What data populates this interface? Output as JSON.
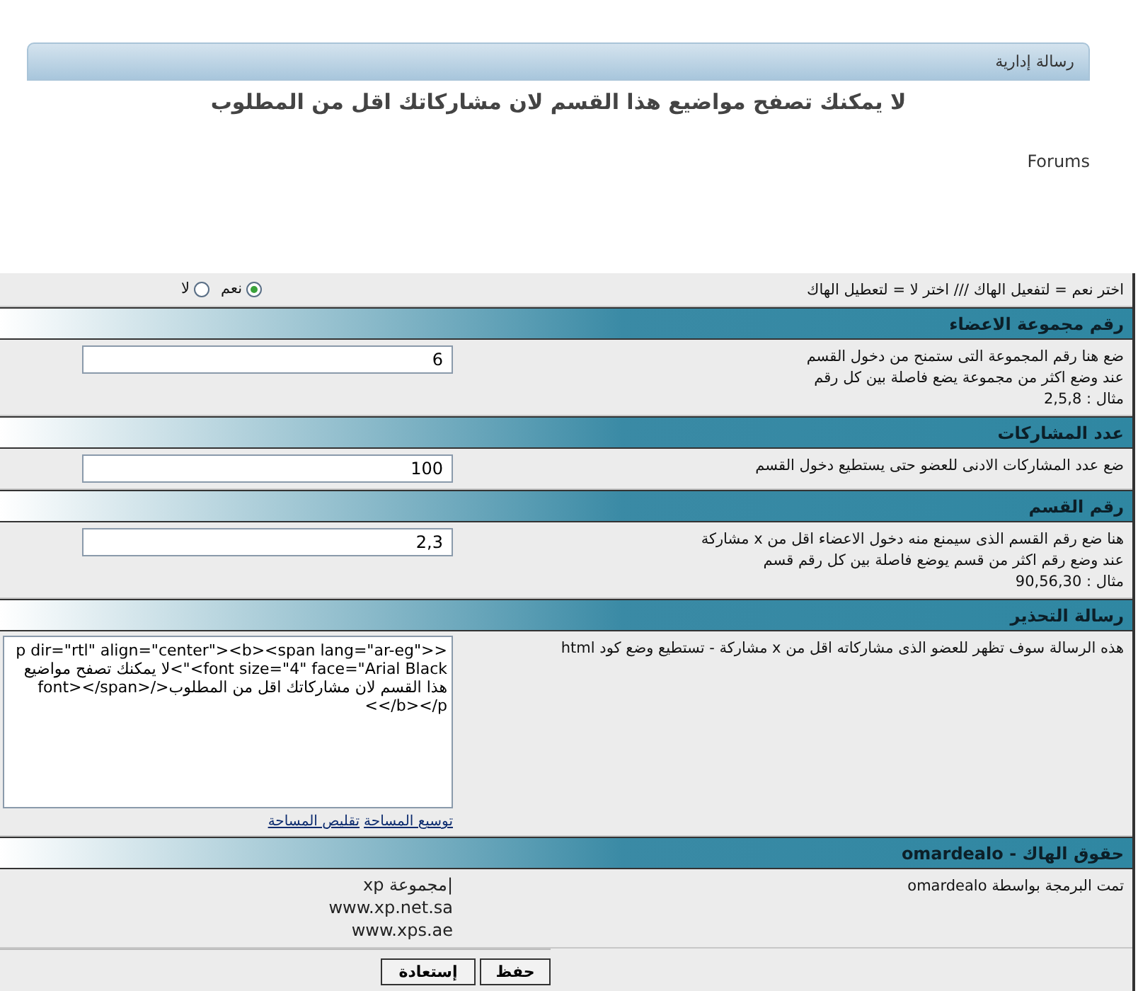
{
  "message_panel": {
    "title": "رسالة إدارية",
    "text": "لا يمكنك تصفح مواضيع هذا القسم لان مشاركاتك اقل من المطلوب"
  },
  "breadcrumb": "Forums",
  "form": [
    {
      "kind": "radio",
      "description": [
        "اختر نعم = لتفعيل الهاك /// اختر لا = لتعطيل الهاك"
      ],
      "options": [
        {
          "label": "نعم",
          "selected": true
        },
        {
          "label": "لا",
          "selected": false
        }
      ]
    },
    {
      "kind": "header",
      "title": "رقم مجموعة الاعضاء"
    },
    {
      "kind": "input",
      "description": [
        "ضع هنا رقم المجموعة التى ستمنح من دخول القسم",
        "عند وضع اكثر من مجموعة يضع فاصلة بين كل رقم",
        "مثال : 2,5,8"
      ],
      "value": "6"
    },
    {
      "kind": "header",
      "title": "عدد المشاركات"
    },
    {
      "kind": "input",
      "description": [
        "ضع عدد المشاركات الادنى للعضو حتى يستطيع دخول القسم"
      ],
      "value": "100"
    },
    {
      "kind": "header",
      "title": "رقم القسم"
    },
    {
      "kind": "input",
      "description": [
        "هنا ضع رقم القسم الذى سيمنع منه دخول الاعضاء اقل من x مشاركة",
        "عند وضع رقم اكثر من قسم يوضع فاصلة بين كل رقم قسم",
        "مثال : 90,56,30"
      ],
      "value": "2,3"
    },
    {
      "kind": "header",
      "title": "رسالة التحذير"
    },
    {
      "kind": "textarea",
      "description": [
        "هذه الرسالة سوف تظهر للعضو الذى مشاركاته اقل من x مشاركة - تستطيع وضع كود html"
      ],
      "value": "<p dir=\"rtl\" align=\"center\"><b><span lang=\"ar-eg\"><font size=\"4\" face=\"Arial Black\">لا يمكنك تصفح مواضيع هذا القسم لان مشاركاتك اقل من المطلوب</font></span></b></p>",
      "links": [
        "توسيع المساحة",
        "تقليص المساحة"
      ]
    },
    {
      "kind": "header",
      "title": "حقوق الهاك - **omardealo**"
    },
    {
      "kind": "credits",
      "description": [
        "تمت البرمجة بواسطة omardealo"
      ],
      "lines": [
        "|مجموعة xp",
        "www.xp.net.sa",
        "www.xps.ae"
      ]
    }
  ],
  "buttons": [
    "حفظ",
    "إستعادة"
  ]
}
